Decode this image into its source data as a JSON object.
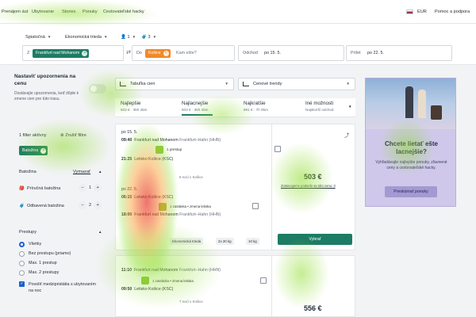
{
  "topnav": {
    "links": [
      "Prenájom áut",
      "Ubytovanie",
      "Stories",
      "Ponuky",
      "Cestovateľské hacky"
    ],
    "currency": "EUR",
    "help": "Pomoc a podpora"
  },
  "search": {
    "trip_type": "Spiatočná",
    "cabin": "Ekonomická trieda",
    "passengers": "1",
    "bags": "3",
    "from_label": "Z",
    "from_value": "Frankfurt nad Mohanom",
    "to_label": "Do",
    "to_value": "Košice",
    "to_placeholder": "Kam ešte?",
    "depart_label": "Odchod",
    "depart_value": "po 15. 5.",
    "return_label": "Prílet",
    "return_value": "po 22. 5."
  },
  "sidebar": {
    "alert_title": "Nastaviť upozornenia na cenu",
    "alert_desc": "Dostávajte upozornenia, keď dôjde k zmene cien pre túto trasu.",
    "filters_active": "1 filter aktívny",
    "clear_filters": "Zrušiť filtre",
    "filter_chip": "Batožina",
    "baggage_title": "Batožina",
    "baggage_clear": "Vymazať",
    "cabin_bag_label": "Príručná batožina",
    "cabin_bag_count": "1",
    "checked_bag_label": "Odbavená batožina",
    "checked_bag_count": "2",
    "stops_title": "Prestupy",
    "stops_options": [
      "Všetky",
      "Bez prestupu (priamo)",
      "Max. 1 prestup",
      "Max. 2 prestupy"
    ],
    "overnight_label": "Povoliť medzipristátia s ubytovaním na noc"
  },
  "controls": {
    "price_table": "Tabuľka cien",
    "price_trends": "Cenové trendy"
  },
  "tabs": [
    {
      "title": "Najlepšie",
      "price": "503 € · 35h 45m"
    },
    {
      "title": "Najlacnejšie",
      "price": "503 € · 35h 45m"
    },
    {
      "title": "Najkratšie",
      "price": "891 € · 7h 05m"
    },
    {
      "title": "Iné možnosti",
      "price": "Najskorší odchod"
    }
  ],
  "result1": {
    "out_date": "po 15. 5.",
    "out_dep_time": "09:40",
    "out_dep_airport": "Frankfurt nad Mohanom",
    "out_dep_code": "Frankfurt–Hahn (HHN)",
    "out_stops": "1 prestup",
    "out_arr_time": "21:25",
    "out_arr_airport": "Letisko Košice (KSC)",
    "nights": "6 nocí v Košice",
    "ret_date": "po 22. 5.",
    "ret_dep_time": "06:15",
    "ret_dep_airport": "Letisko Košice (KSC)",
    "ret_stops": "1 zastávka • zmena letiska",
    "ret_arr_time": "18:00",
    "ret_arr_airport": "Frankfurt nad Mohanom",
    "ret_arr_code": "Frankfurt–Hahn (HHN)",
    "tag_label": "Ekonomická trieda",
    "bag_tag1": "2x 20 kg",
    "bag_tag2": "10 kg",
    "price": "503 €",
    "price_note": "Zostavujeme podarilo sa túto cenu: 3",
    "select_button": "Vybrať"
  },
  "result2": {
    "out_dep_time": "11:10",
    "out_dep_airport": "Frankfurt nad Mohanom",
    "out_dep_code": "Frankfurt–Hahn (HHN)",
    "out_stops": "1 zastávka • zmena letiska",
    "out_arr_time": "09:50",
    "out_arr_airport": "Letisko Košice (KSC)",
    "nights": "7 nocí v Košice",
    "price": "556 €"
  },
  "promo": {
    "heading": "Chcete lietať ešte lacnejšie?",
    "desc": "Vyhľadávajte najlepšie ponuky, zľavnené ceny a cestovateľské hacky.",
    "button": "Preskúmať ponuky"
  }
}
